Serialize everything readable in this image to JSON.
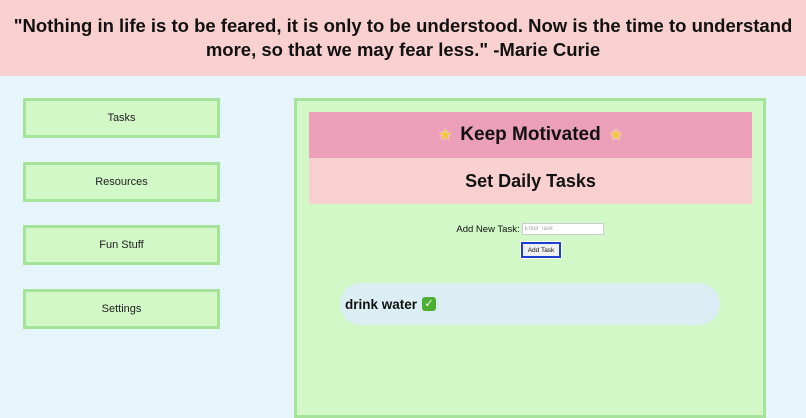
{
  "banner": {
    "quote": "\"Nothing in life is to be feared, it is only to be understood. Now is the time to understand more, so that we may fear less.\" -Marie Curie"
  },
  "sidebar": {
    "items": [
      {
        "label": "Tasks"
      },
      {
        "label": "Resources"
      },
      {
        "label": "Fun Stuff"
      },
      {
        "label": "Settings"
      }
    ]
  },
  "main": {
    "motivate_title": "Keep Motivated",
    "daily_title": "Set Daily Tasks",
    "add_label": "Add New Task:",
    "input_placeholder": "Enter Task",
    "input_value": "",
    "add_button": "Add Task",
    "tasks": [
      {
        "text": "drink water",
        "icon": "check-mark-icon"
      }
    ]
  },
  "colors": {
    "banner_bg": "#f9d0d0",
    "page_bg": "#e6f5fc",
    "nav_bg": "#d1f8c6",
    "nav_border": "#a6e39a",
    "motivate_bg": "#eb9fb8",
    "button_focus_border": "#1d3ed1",
    "task_bg": "#dbeef4"
  }
}
